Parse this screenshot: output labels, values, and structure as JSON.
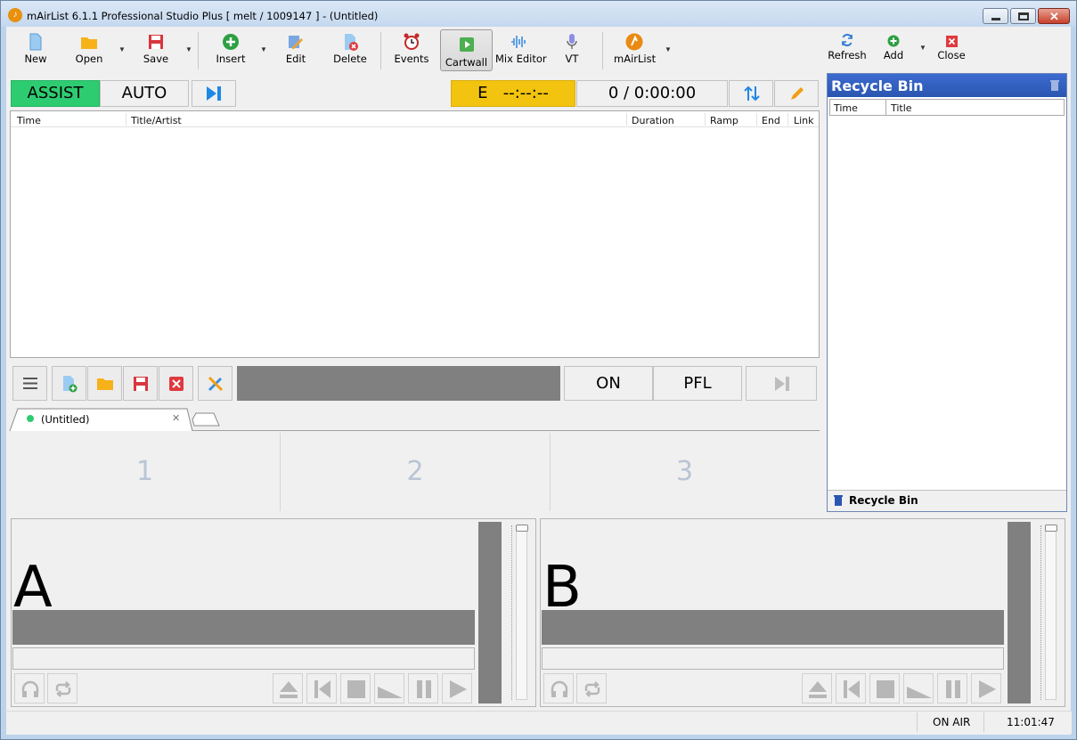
{
  "window": {
    "title": "mAirList 6.1.1 Professional Studio Plus [ melt / 1009147 ] - (Untitled)"
  },
  "toolbar": {
    "new": "New",
    "open": "Open",
    "save": "Save",
    "insert": "Insert",
    "edit": "Edit",
    "delete": "Delete",
    "events": "Events",
    "cartwall": "Cartwall",
    "mix_editor": "Mix Editor",
    "vt": "VT",
    "mairlist": "mAirList",
    "refresh": "Refresh",
    "add": "Add",
    "close": "Close"
  },
  "mode": {
    "assist": "ASSIST",
    "auto": "AUTO",
    "timer": "E   --:--:--",
    "counter": "0 / 0:00:00"
  },
  "playlist": {
    "columns": [
      "Time",
      "Title/Artist",
      "Duration",
      "Ramp",
      "End",
      "Link"
    ]
  },
  "recycle": {
    "title": "Recycle Bin",
    "columns": [
      "Time",
      "Title"
    ],
    "footer": "Recycle Bin"
  },
  "cartwall": {
    "on": "ON",
    "pfl": "PFL",
    "tab": "(Untitled)",
    "cells": [
      "1",
      "2",
      "3"
    ]
  },
  "players": {
    "a": "A",
    "b": "B"
  },
  "status": {
    "on_air": "ON AIR",
    "time": "11:01:47"
  },
  "colors": {
    "assist": "#2ecc71",
    "timer": "#f2c30f",
    "accent": "#1e88e5",
    "recycle_header": "#2a56b0"
  }
}
